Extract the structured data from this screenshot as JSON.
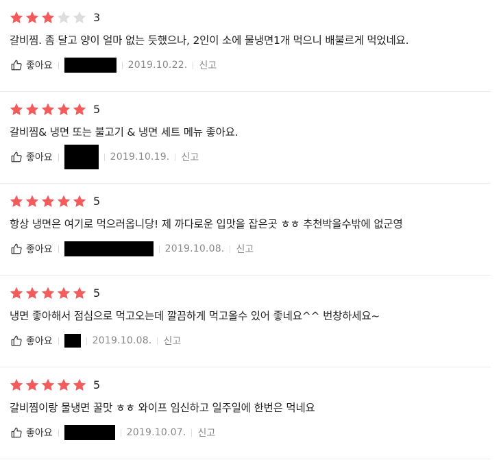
{
  "labels": {
    "like": "좋아요",
    "report": "신고"
  },
  "colors": {
    "star_filled": "#f25c5c",
    "star_empty": "#dddddd",
    "author_redaction": "#000000"
  },
  "reviews": [
    {
      "rating": 3,
      "score_text": "3",
      "text": "갈비찜. 좀 달고 양이 얼마 없는 듯했으나, 2인이 소에 물냉면1개 먹으니 배불르게 먹었네요.",
      "author_redacted": true,
      "date": "2019.10.22."
    },
    {
      "rating": 5,
      "score_text": "5",
      "text": "갈비찜& 냉면 또는 불고기 & 냉면 세트 메뉴 좋아요.",
      "author_redacted": true,
      "date": "2019.10.19."
    },
    {
      "rating": 5,
      "score_text": "5",
      "text": "항상 냉면은 여기로 먹으러옵니당! 제 까다로운 입맛을 잡은곳 ㅎㅎ 추천박을수밖에 없군영",
      "author_redacted": true,
      "date": "2019.10.08."
    },
    {
      "rating": 5,
      "score_text": "5",
      "text": "냉면 좋아해서 점심으로 먹고오는데 깔끔하게 먹고올수 있어 좋네요^^ 번창하세요~",
      "author_redacted": true,
      "date": "2019.10.08."
    },
    {
      "rating": 5,
      "score_text": "5",
      "text": "갈비찜이랑 물냉면 꿀맛 ㅎㅎ 와이프 임신하고 일주일에 한번은 먹네요",
      "author_redacted": true,
      "date": "2019.10.07."
    }
  ]
}
